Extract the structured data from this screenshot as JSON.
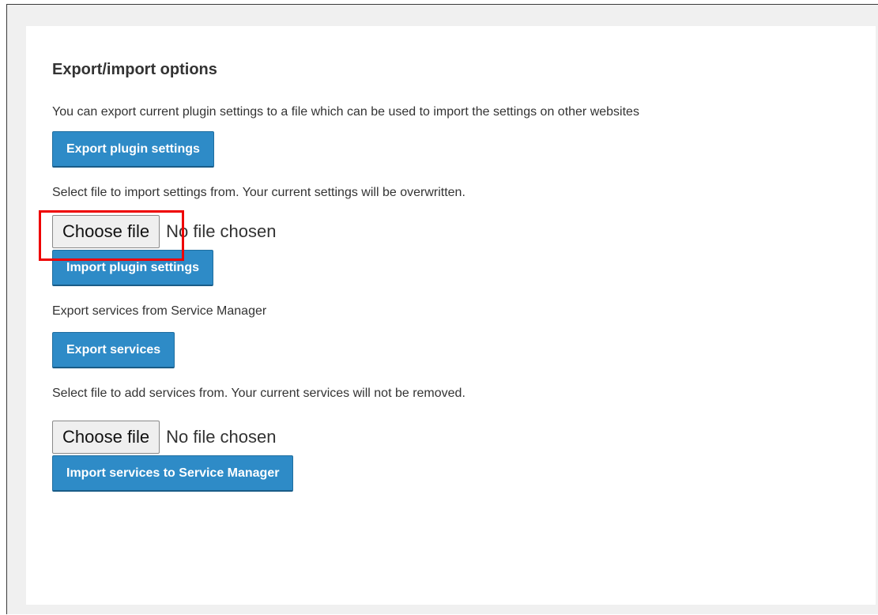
{
  "section": {
    "title": "Export/import options"
  },
  "export_settings": {
    "description": "You can export current plugin settings to a file which can be used to import the settings on other websites",
    "button_label": "Export plugin settings"
  },
  "import_settings": {
    "description": "Select file to import settings from. Your current settings will be overwritten.",
    "choose_label": "Choose file",
    "file_status": "No file chosen",
    "button_label": "Import plugin settings"
  },
  "export_services": {
    "description": "Export services from Service Manager",
    "button_label": "Export services"
  },
  "import_services": {
    "description": "Select file to add services from. Your current services will not be removed.",
    "choose_label": "Choose file",
    "file_status": "No file chosen",
    "button_label": "Import services to Service Manager"
  },
  "colors": {
    "primary_button": "#2e8bc7",
    "highlight": "#ee0000"
  }
}
